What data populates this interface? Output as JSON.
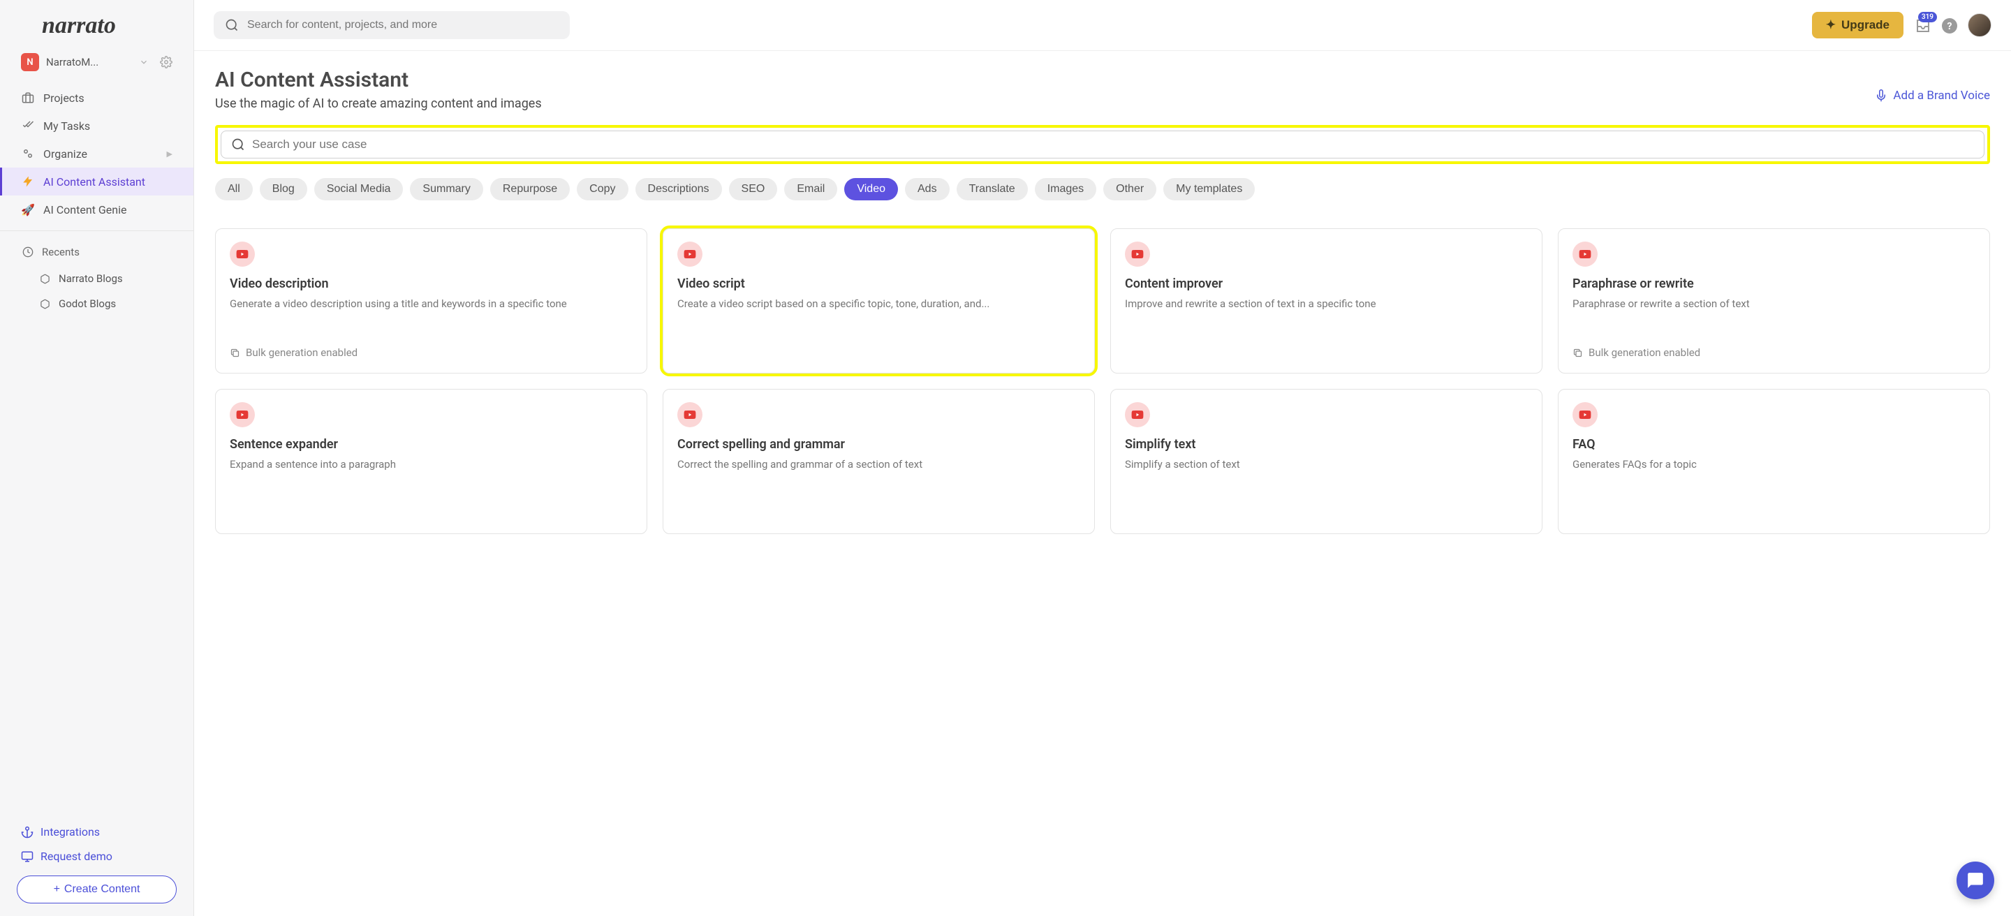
{
  "brand": "narrato",
  "workspace": {
    "badge": "N",
    "name": "NarratoM..."
  },
  "sidebar": {
    "projects": "Projects",
    "my_tasks": "My Tasks",
    "organize": "Organize",
    "ai_assistant": "AI Content Assistant",
    "ai_genie": "AI Content Genie",
    "recents_label": "Recents",
    "recents": [
      "Narrato Blogs",
      "Godot Blogs"
    ],
    "integrations": "Integrations",
    "request_demo": "Request demo",
    "create_content": "Create Content"
  },
  "topbar": {
    "search_placeholder": "Search for content, projects, and more",
    "upgrade": "Upgrade",
    "badge": "319"
  },
  "page": {
    "title": "AI Content Assistant",
    "subtitle": "Use the magic of AI to create amazing content and images",
    "add_brand_voice": "Add a Brand Voice",
    "use_case_placeholder": "Search your use case"
  },
  "chips": [
    "All",
    "Blog",
    "Social Media",
    "Summary",
    "Repurpose",
    "Copy",
    "Descriptions",
    "SEO",
    "Email",
    "Video",
    "Ads",
    "Translate",
    "Images",
    "Other",
    "My templates"
  ],
  "chips_active": "Video",
  "bulk_label": "Bulk generation enabled",
  "cards": [
    {
      "title": "Video description",
      "desc": "Generate a video description using a title and keywords in a specific tone",
      "bulk": true,
      "highlight": false
    },
    {
      "title": "Video script",
      "desc": "Create a video script based on a specific topic, tone, duration, and...",
      "bulk": false,
      "highlight": true
    },
    {
      "title": "Content improver",
      "desc": "Improve and rewrite a section of text in a specific tone",
      "bulk": false,
      "highlight": false
    },
    {
      "title": "Paraphrase or rewrite",
      "desc": "Paraphrase or rewrite a section of text",
      "bulk": true,
      "highlight": false
    },
    {
      "title": "Sentence expander",
      "desc": "Expand a sentence into a paragraph",
      "bulk": false,
      "highlight": false
    },
    {
      "title": "Correct spelling and grammar",
      "desc": "Correct the spelling and grammar of a section of text",
      "bulk": false,
      "highlight": false
    },
    {
      "title": "Simplify text",
      "desc": "Simplify a section of text",
      "bulk": false,
      "highlight": false
    },
    {
      "title": "FAQ",
      "desc": "Generates FAQs for a topic",
      "bulk": false,
      "highlight": false
    }
  ]
}
